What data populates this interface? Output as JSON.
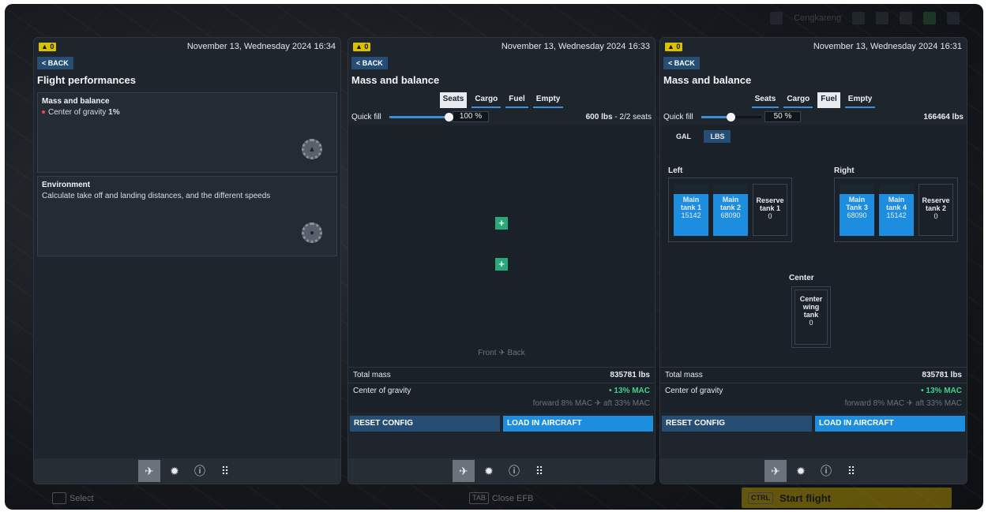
{
  "background": {
    "top_status": "Cengkareng",
    "bottom": {
      "select_label": "Select",
      "tab_key": "TAB",
      "close_label": "Close EFB",
      "ctrl_key": "CTRL",
      "start_label": "Start flight"
    }
  },
  "panel1": {
    "alert_count": "0",
    "datetime": "November 13, Wednesday 2024 16:34",
    "back_label": "BACK",
    "title": "Flight performances",
    "cards": [
      {
        "title": "Mass and balance",
        "line_label": "Center of gravity",
        "line_value": "1%"
      },
      {
        "title": "Environment",
        "text": "Calculate take off and landing distances, and the different speeds"
      }
    ]
  },
  "panel2": {
    "alert_count": "0",
    "datetime": "November 13, Wednesday 2024 16:33",
    "back_label": "BACK",
    "title": "Mass and balance",
    "tabs": [
      "Seats",
      "Cargo",
      "Fuel",
      "Empty"
    ],
    "active_tab": "Seats",
    "quickfill_label": "Quick fill",
    "quickfill_value": "100 %",
    "quickfill_fraction": 1.0,
    "summary_bold": "600 lbs",
    "summary_rest": " - 2/2 seats",
    "front_label": "Front",
    "back_seat_label": "Back",
    "total_mass_label": "Total mass",
    "total_mass_value": "835781 lbs",
    "cog_label": "Center of gravity",
    "cog_value": "13% MAC",
    "forward_label": "forward 8% MAC",
    "aft_label": "aft 33% MAC",
    "reset_label": "RESET CONFIG",
    "load_label": "LOAD IN AIRCRAFT"
  },
  "panel3": {
    "alert_count": "0",
    "datetime": "November 13, Wednesday 2024 16:31",
    "back_label": "BACK",
    "title": "Mass and balance",
    "tabs": [
      "Seats",
      "Cargo",
      "Fuel",
      "Empty"
    ],
    "active_tab": "Fuel",
    "quickfill_label": "Quick fill",
    "quickfill_value": "50 %",
    "quickfill_fraction": 0.5,
    "summary_bold": "166464 lbs",
    "units": [
      "GAL",
      "LBS"
    ],
    "left_label": "Left",
    "right_label": "Right",
    "center_label": "Center",
    "tanks_left": [
      {
        "line1": "Main",
        "line2": "tank 1",
        "value": "15142"
      },
      {
        "line1": "Main",
        "line2": "tank 2",
        "value": "68090"
      },
      {
        "line1": "Reserve",
        "line2": "tank 1",
        "value": "0"
      }
    ],
    "tanks_right": [
      {
        "line1": "Main",
        "line2": "Tank 3",
        "value": "68090"
      },
      {
        "line1": "Main",
        "line2": "tank 4",
        "value": "15142"
      },
      {
        "line1": "Reserve",
        "line2": "tank 2",
        "value": "0"
      }
    ],
    "tank_center": {
      "line1": "Center",
      "line2": "wing",
      "line3": "tank",
      "value": "0"
    },
    "total_mass_label": "Total mass",
    "total_mass_value": "835781 lbs",
    "cog_label": "Center of gravity",
    "cog_value": "13% MAC",
    "forward_label": "forward 8% MAC",
    "aft_label": "aft 33% MAC",
    "reset_label": "RESET CONFIG",
    "load_label": "LOAD IN AIRCRAFT"
  },
  "icons": {
    "plane": "airplane-icon",
    "settings": "gear-icon",
    "info": "info-icon",
    "apps": "grid-icon"
  }
}
